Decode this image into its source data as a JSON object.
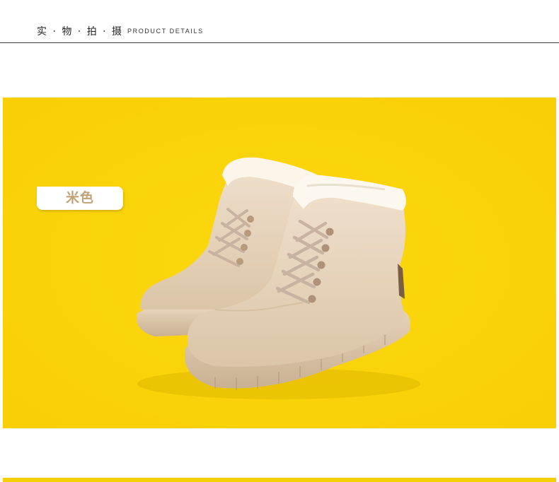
{
  "header": {
    "title": "实 · 物 · 拍 · 摄",
    "subtitle": "PRODUCT DETAILS"
  },
  "photo": {
    "subject": "boots-icon",
    "background_color": "#fbd40a",
    "product_color": "#e9d6bf"
  },
  "color_tag": {
    "label": "米色"
  },
  "colors": {
    "accent_yellow": "#fbd40a",
    "tag_text": "#c2a277",
    "rule": "#3a3a3a"
  }
}
